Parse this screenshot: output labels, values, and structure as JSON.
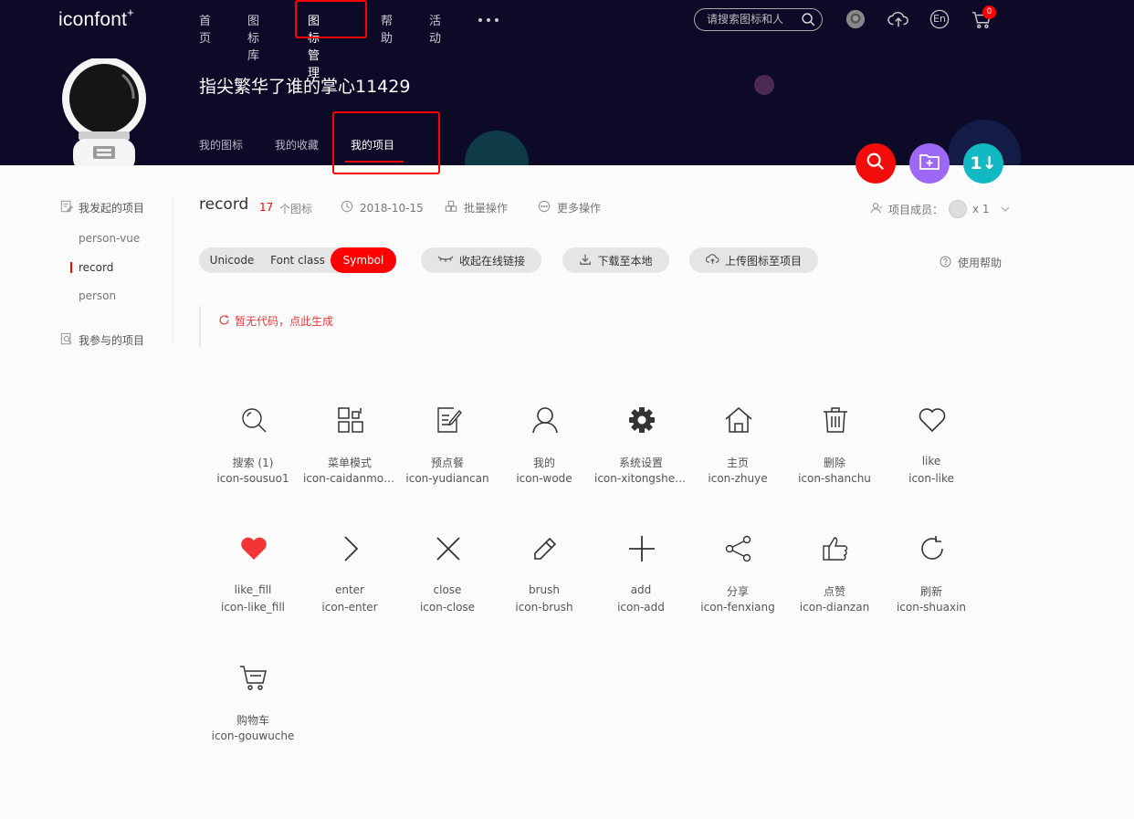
{
  "header": {
    "logo": "iconfont",
    "logo_mark": "+",
    "nav": [
      {
        "label": "首页"
      },
      {
        "label": "图标库"
      },
      {
        "label": "图标管理"
      },
      {
        "label": "帮助"
      },
      {
        "label": "活动"
      }
    ],
    "search_placeholder": "请搜索图标和人",
    "cart_count": "0",
    "lang_label": "En"
  },
  "profile": {
    "username": "指尖繁华了谁的掌心11429",
    "tabs": [
      {
        "label": "我的图标"
      },
      {
        "label": "我的收藏"
      },
      {
        "label": "我的项目"
      }
    ],
    "action_sort_label": "1↓"
  },
  "sidebar": {
    "group_started": "我发起的项目",
    "projects": [
      {
        "label": "person-vue"
      },
      {
        "label": "record"
      },
      {
        "label": "person"
      }
    ],
    "group_joined": "我参与的项目"
  },
  "project": {
    "title": "record",
    "count": "17",
    "count_label": "个图标",
    "date": "2018-10-15",
    "batch_label": "批量操作",
    "more_label": "更多操作",
    "members_label": "项目成员：",
    "members_count": "x 1"
  },
  "toolbar": {
    "modes": [
      {
        "label": "Unicode"
      },
      {
        "label": "Font class"
      },
      {
        "label": "Symbol"
      }
    ],
    "collapse_label": "收起在线链接",
    "download_label": "下载至本地",
    "upload_label": "上传图标至项目",
    "help_label": "使用帮助"
  },
  "code": {
    "message": "暂无代码，点此生成"
  },
  "icons": [
    {
      "name": "搜索 (1)",
      "code": "icon-sousuo1",
      "glyph": "search-icon"
    },
    {
      "name": "菜单模式",
      "code": "icon-caidanmoshi",
      "glyph": "grid-menu-icon"
    },
    {
      "name": "预点餐",
      "code": "icon-yudiancan",
      "glyph": "edit-note-icon"
    },
    {
      "name": "我的",
      "code": "icon-wode",
      "glyph": "user-icon"
    },
    {
      "name": "系统设置",
      "code": "icon-xitongshezhi",
      "glyph": "gear-icon"
    },
    {
      "name": "主页",
      "code": "icon-zhuye",
      "glyph": "home-icon"
    },
    {
      "name": "删除",
      "code": "icon-shanchu",
      "glyph": "trash-icon"
    },
    {
      "name": "like",
      "code": "icon-like",
      "glyph": "heart-outline-icon"
    },
    {
      "name": "like_fill",
      "code": "icon-like_fill",
      "glyph": "heart-fill-icon"
    },
    {
      "name": "enter",
      "code": "icon-enter",
      "glyph": "chevron-right-icon"
    },
    {
      "name": "close",
      "code": "icon-close",
      "glyph": "close-icon"
    },
    {
      "name": "brush",
      "code": "icon-brush",
      "glyph": "pencil-icon"
    },
    {
      "name": "add",
      "code": "icon-add",
      "glyph": "plus-icon"
    },
    {
      "name": "分享",
      "code": "icon-fenxiang",
      "glyph": "share-icon"
    },
    {
      "name": "点赞",
      "code": "icon-dianzan",
      "glyph": "thumbs-up-icon"
    },
    {
      "name": "刷新",
      "code": "icon-shuaxin",
      "glyph": "refresh-icon"
    },
    {
      "name": "购物车",
      "code": "icon-gouwuche",
      "glyph": "cart-icon"
    }
  ],
  "colors": {
    "header_bg": "#0c0a26",
    "accent": "#ff0000",
    "search_btn": "#f20c0c",
    "new_folder_btn": "#9d68f6",
    "sort_btn": "#12b8c2",
    "like_fill": "#f23535"
  }
}
